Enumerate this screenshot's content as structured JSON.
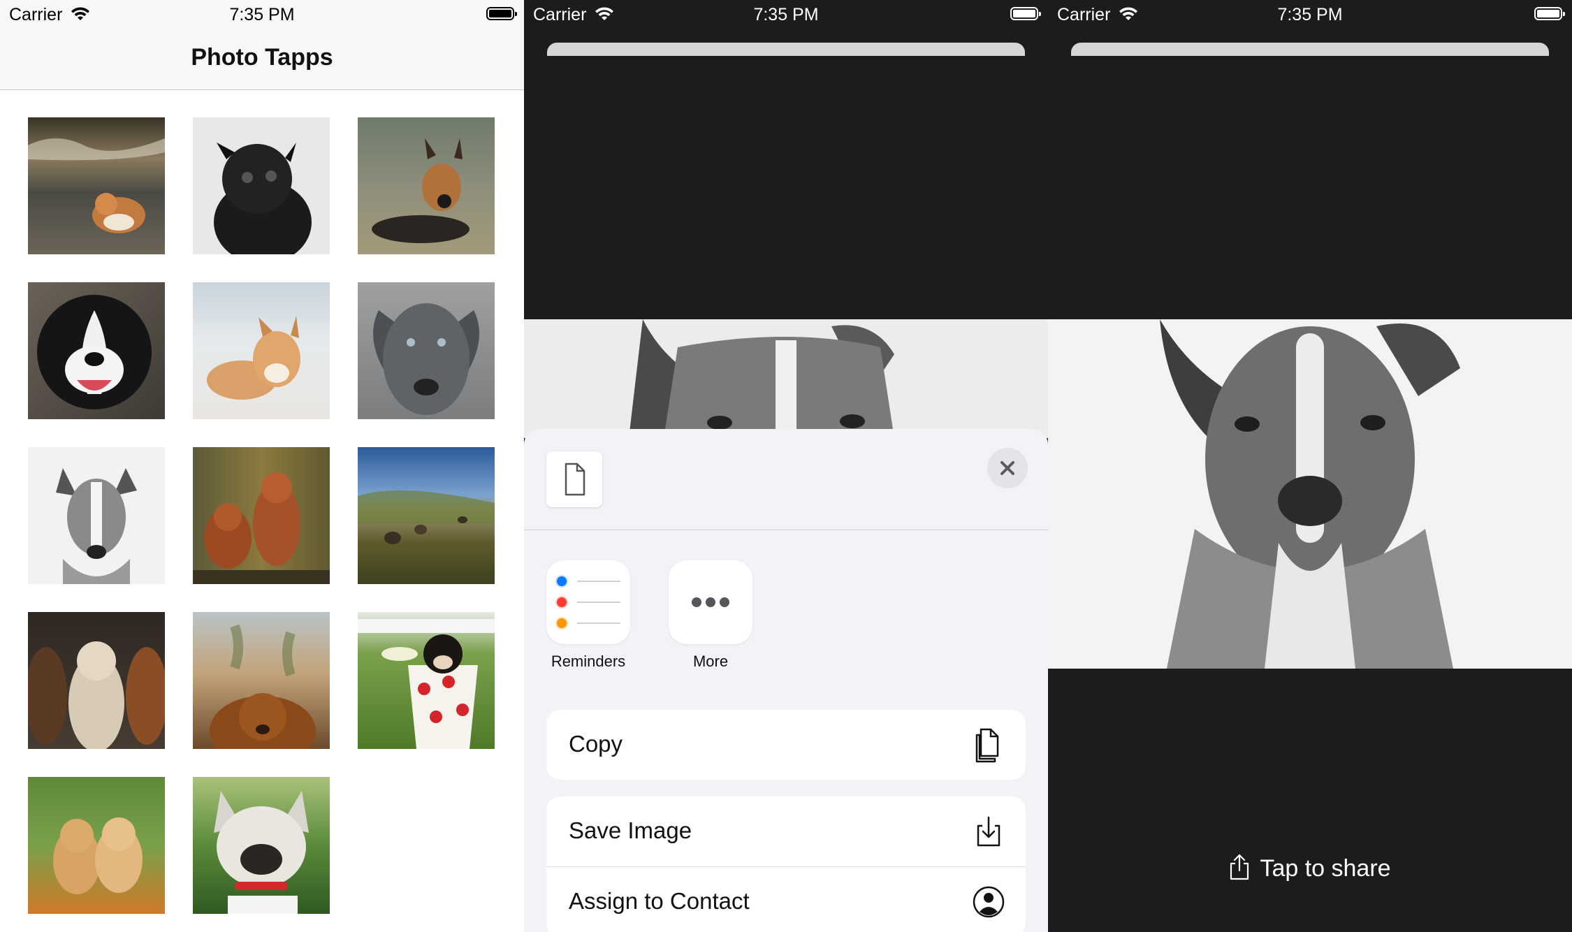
{
  "status_bar": {
    "carrier": "Carrier",
    "time": "7:35 PM"
  },
  "gallery": {
    "title": "Photo Tapps",
    "photos": [
      {
        "name": "photo-bulldog-beach"
      },
      {
        "name": "photo-black-pug"
      },
      {
        "name": "photo-german-shepherd"
      },
      {
        "name": "photo-border-collie"
      },
      {
        "name": "photo-shiba-puppy"
      },
      {
        "name": "photo-grey-pitbull"
      },
      {
        "name": "photo-bw-terrier"
      },
      {
        "name": "photo-vizsla-pair"
      },
      {
        "name": "photo-dogs-field"
      },
      {
        "name": "photo-three-dogs"
      },
      {
        "name": "photo-golden-retriever"
      },
      {
        "name": "photo-puppy-in-cup"
      },
      {
        "name": "photo-golden-puppies"
      },
      {
        "name": "photo-french-bulldog"
      }
    ]
  },
  "share_sheet": {
    "apps": [
      {
        "label": "Reminders",
        "icon": "reminders-icon"
      },
      {
        "label": "More",
        "icon": "more-icon"
      }
    ],
    "actions": {
      "copy": {
        "label": "Copy",
        "icon": "copy-icon"
      },
      "save_image": {
        "label": "Save Image",
        "icon": "save-image-icon"
      },
      "assign_contact": {
        "label": "Assign to Contact",
        "icon": "contact-icon"
      }
    },
    "colors": {
      "reminder_blue": "#0a7aff",
      "reminder_red": "#ff3b30",
      "reminder_orange": "#ff9500"
    }
  },
  "detail": {
    "share_prompt": "Tap to share"
  }
}
